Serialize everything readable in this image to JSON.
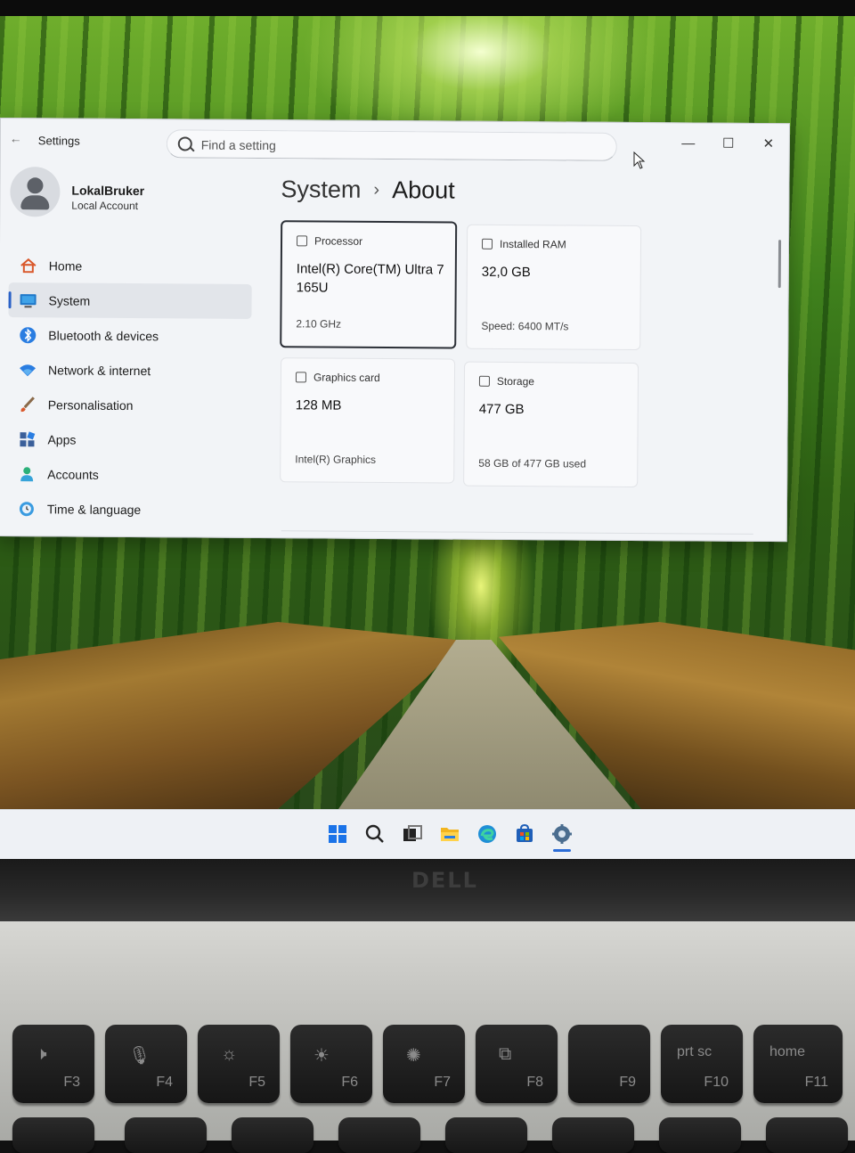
{
  "window": {
    "app_title": "Settings",
    "search_placeholder": "Find a setting"
  },
  "account": {
    "name": "LokalBruker",
    "type": "Local Account"
  },
  "nav": [
    {
      "label": "Home",
      "icon": "home-icon"
    },
    {
      "label": "System",
      "icon": "system-icon",
      "selected": true
    },
    {
      "label": "Bluetooth & devices",
      "icon": "bluetooth-icon"
    },
    {
      "label": "Network & internet",
      "icon": "wifi-icon"
    },
    {
      "label": "Personalisation",
      "icon": "brush-icon"
    },
    {
      "label": "Apps",
      "icon": "apps-icon"
    },
    {
      "label": "Accounts",
      "icon": "person-icon"
    },
    {
      "label": "Time & language",
      "icon": "clock-globe-icon"
    }
  ],
  "breadcrumb": {
    "parent": "System",
    "separator": "›",
    "current": "About"
  },
  "specs": {
    "processor": {
      "title": "Processor",
      "value": "Intel(R) Core(TM) Ultra 7 165U",
      "footer": "2.10 GHz"
    },
    "ram": {
      "title": "Installed RAM",
      "value": "32,0 GB",
      "footer": "Speed: 6400 MT/s"
    },
    "graphics": {
      "title": "Graphics card",
      "value": "128 MB",
      "footer": "Intel(R) Graphics"
    },
    "storage": {
      "title": "Storage",
      "value": "477 GB",
      "footer": "58 GB of 477 GB used"
    }
  },
  "taskbar": {
    "icons": [
      "windows-start-icon",
      "search-icon",
      "task-view-icon",
      "file-explorer-icon",
      "edge-icon",
      "store-icon",
      "settings-icon"
    ],
    "active": "settings-icon"
  },
  "laptop": {
    "brand": "DELL",
    "keys": [
      {
        "symbol": "🕨",
        "fn": "F3"
      },
      {
        "symbol": "🎙",
        "fn": "F4"
      },
      {
        "symbol": "☼",
        "fn": "F5"
      },
      {
        "symbol": "☀",
        "fn": "F6"
      },
      {
        "symbol": "✺",
        "fn": "F7"
      },
      {
        "symbol": "⧉",
        "fn": "F8"
      },
      {
        "symbol": "",
        "fn": "F9"
      },
      {
        "symbol": "prt sc",
        "fn": "F10"
      },
      {
        "symbol": "home",
        "fn": "F11"
      }
    ]
  },
  "colors": {
    "accent": "#2b62c7",
    "window_bg": "#f2f4f7",
    "card_bg": "#f8f9fb"
  }
}
